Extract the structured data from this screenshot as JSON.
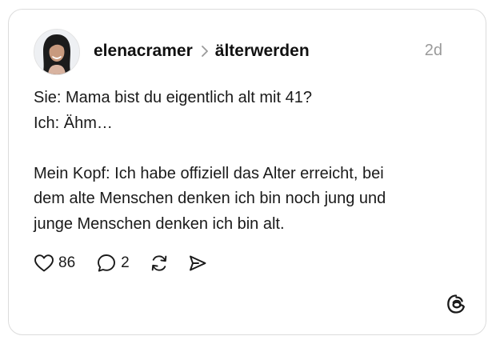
{
  "post": {
    "author": "elenacramer",
    "topic": "älterwerden",
    "timestamp": "2d",
    "lines": [
      "Sie: Mama bist du eigentlich alt mit 41?",
      "Ich: Ähm…",
      "Mein Kopf: Ich habe offiziell das Alter erreicht, bei",
      "dem alte Menschen denken ich bin noch jung und",
      "junge Menschen denken ich bin alt."
    ]
  },
  "actions": {
    "likes": "86",
    "replies": "2"
  },
  "icons": {
    "separator": "chevron-right-icon",
    "like": "heart-icon",
    "reply": "speech-bubble-icon",
    "repost": "repost-icon",
    "share": "send-icon",
    "brand": "threads-logo-icon"
  },
  "colors": {
    "text": "#1a1a1a",
    "muted": "#9a9a9a",
    "border": "#dcdcdc",
    "background": "#ffffff"
  }
}
